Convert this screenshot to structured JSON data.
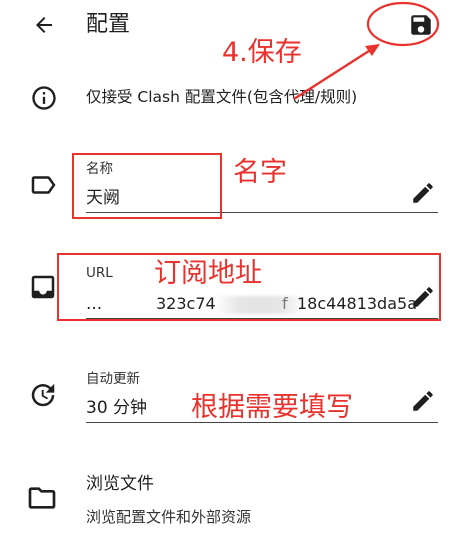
{
  "app_bar": {
    "title": "配置",
    "back_icon": "arrow-back-icon",
    "save_icon": "save-icon"
  },
  "info": {
    "icon": "info-icon",
    "text": "仅接受 Clash 配置文件(包含代理/规则)"
  },
  "fields": {
    "name": {
      "icon": "label-icon",
      "label": "名称",
      "value": "天阙",
      "edit_icon": "edit-pencil-icon"
    },
    "url": {
      "icon": "inbox-icon",
      "label": "URL",
      "value_prefix": "...",
      "value_visible_a": "323c74",
      "value_visible_b": "f",
      "value_visible_c": "18c44813da5a",
      "edit_icon": "edit-pencil-icon"
    },
    "auto_update": {
      "icon": "update-clock-icon",
      "label": "自动更新",
      "value": "30 分钟",
      "edit_icon": "edit-pencil-icon"
    }
  },
  "browse": {
    "icon": "folder-icon",
    "title": "浏览文件",
    "subtitle": "浏览配置文件和外部资源"
  },
  "annotations": {
    "save_step": "4.保存",
    "name_note": "名字",
    "url_note": "订阅地址",
    "update_note": "根据需要填写",
    "color": "#e8322d"
  }
}
